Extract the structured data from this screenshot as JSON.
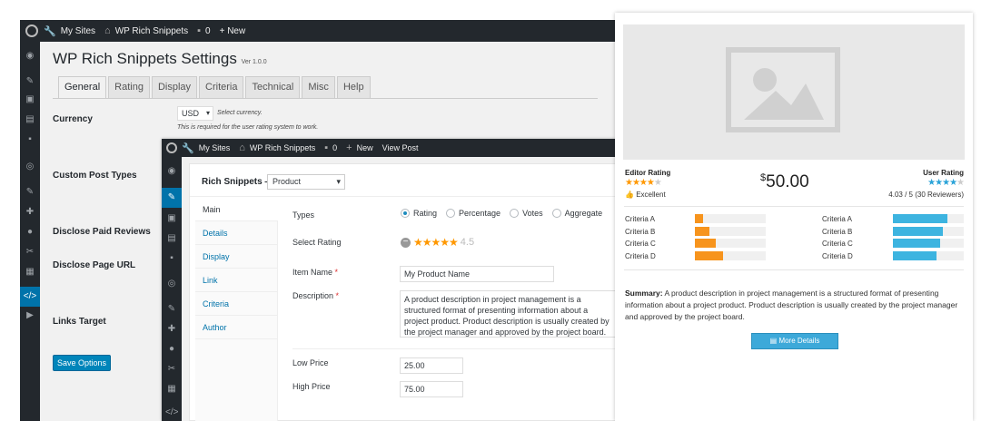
{
  "back_window": {
    "adminbar": {
      "my_sites": "My Sites",
      "site_name": "WP Rich Snippets",
      "comments": "0",
      "new": "+ New"
    },
    "title": "WP Rich Snippets Settings",
    "version": "Ver 1.0.0",
    "tabs": [
      "General",
      "Rating",
      "Display",
      "Criteria",
      "Technical",
      "Misc",
      "Help"
    ],
    "fields": {
      "currency_label": "Currency",
      "currency_value": "USD",
      "currency_hint": "Select currency.",
      "currency_desc": "This is required for the user rating system to work.",
      "custom_post_types": "Custom Post Types",
      "disclose_paid_reviews": "Disclose Paid Reviews",
      "disclose_page_url": "Disclose Page URL",
      "links_target": "Links Target"
    },
    "save_button": "Save Options"
  },
  "middle_window": {
    "adminbar": {
      "my_sites": "My Sites",
      "site_name": "WP Rich Snippets",
      "comments": "0",
      "new": "New",
      "view_post": "View Post"
    },
    "metabox_title": "Rich Snippets —",
    "type_select": "Product",
    "vtabs": [
      "Main",
      "Details",
      "Display",
      "Link",
      "Criteria",
      "Author"
    ],
    "labels": {
      "types": "Types",
      "select_rating": "Select Rating",
      "item_name": "Item Name",
      "description": "Description",
      "low_price": "Low Price",
      "high_price": "High Price"
    },
    "type_options": [
      "Rating",
      "Percentage",
      "Votes",
      "Aggregate"
    ],
    "selected_type": "Rating",
    "rating_value": "4.5",
    "item_name_value": "My Product Name",
    "description_value": "A product description in project management is a structured format of presenting information about a project product. Product description is usually created by the project manager and approved by the project board.",
    "low_price_value": "25.00",
    "high_price_value": "75.00"
  },
  "front_card": {
    "editor_rating_label": "Editor Rating",
    "editor_rating_stars": 4,
    "editor_rating_word": "Excellent",
    "price": "50.00",
    "currency_symbol": "$",
    "user_rating_label": "User Rating",
    "user_rating_stars": 4,
    "user_rating_score": "4.03 / 5 (30 Reviewers)",
    "editor_criteria": [
      {
        "name": "Criteria A",
        "value": 0.12
      },
      {
        "name": "Criteria B",
        "value": 0.2
      },
      {
        "name": "Criteria C",
        "value": 0.3
      },
      {
        "name": "Criteria D",
        "value": 0.4
      }
    ],
    "user_criteria": [
      {
        "name": "Criteria A",
        "value": 0.77
      },
      {
        "name": "Criteria B",
        "value": 0.7
      },
      {
        "name": "Criteria C",
        "value": 0.67
      },
      {
        "name": "Criteria D",
        "value": 0.62
      }
    ],
    "summary_label": "Summary:",
    "summary_text": "A product description in project management is a structured format of presenting information about a project product. Product description is usually created by the project manager and approved by the project board.",
    "more_button": "More Details",
    "colors": {
      "editor_bar": "#f7941d",
      "user_bar": "#3db4e0",
      "button": "#3da9d9"
    }
  }
}
